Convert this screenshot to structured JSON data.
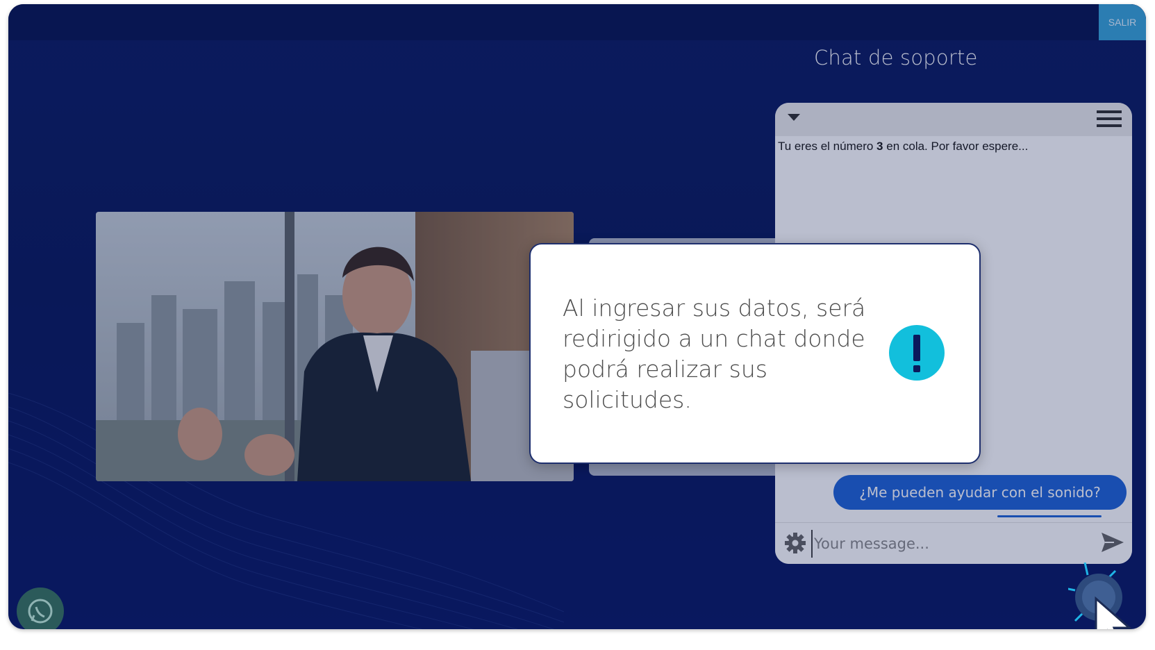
{
  "header": {
    "exit_label": "SALIR"
  },
  "chat_section": {
    "title": "Chat de soporte"
  },
  "video": {
    "icon": "presenter-video"
  },
  "chat_widget": {
    "queue_prefix": "Tu eres el número ",
    "queue_number": "3",
    "queue_suffix": " en cola. Por favor espere...",
    "user_message": "¿Me pueden ayudar con el sonido?",
    "input_placeholder": "Your message...",
    "icons": {
      "collapse": "chevron-down-icon",
      "menu": "hamburger-menu-icon",
      "settings": "gear-icon",
      "send": "send-icon"
    }
  },
  "notice": {
    "text": "Al ingresar sus datos, será redirigido a un chat donde podrá realizar sus solicitudes.",
    "icon": "exclamation-icon",
    "icon_color": "#12bfdc"
  },
  "floating": {
    "whatsapp_icon": "whatsapp-icon",
    "chat_launcher_icon": "chat-launcher-icon"
  },
  "colors": {
    "background": "#0b1a5c",
    "accent": "#2065d6",
    "exit_button": "#3aa6d9"
  }
}
